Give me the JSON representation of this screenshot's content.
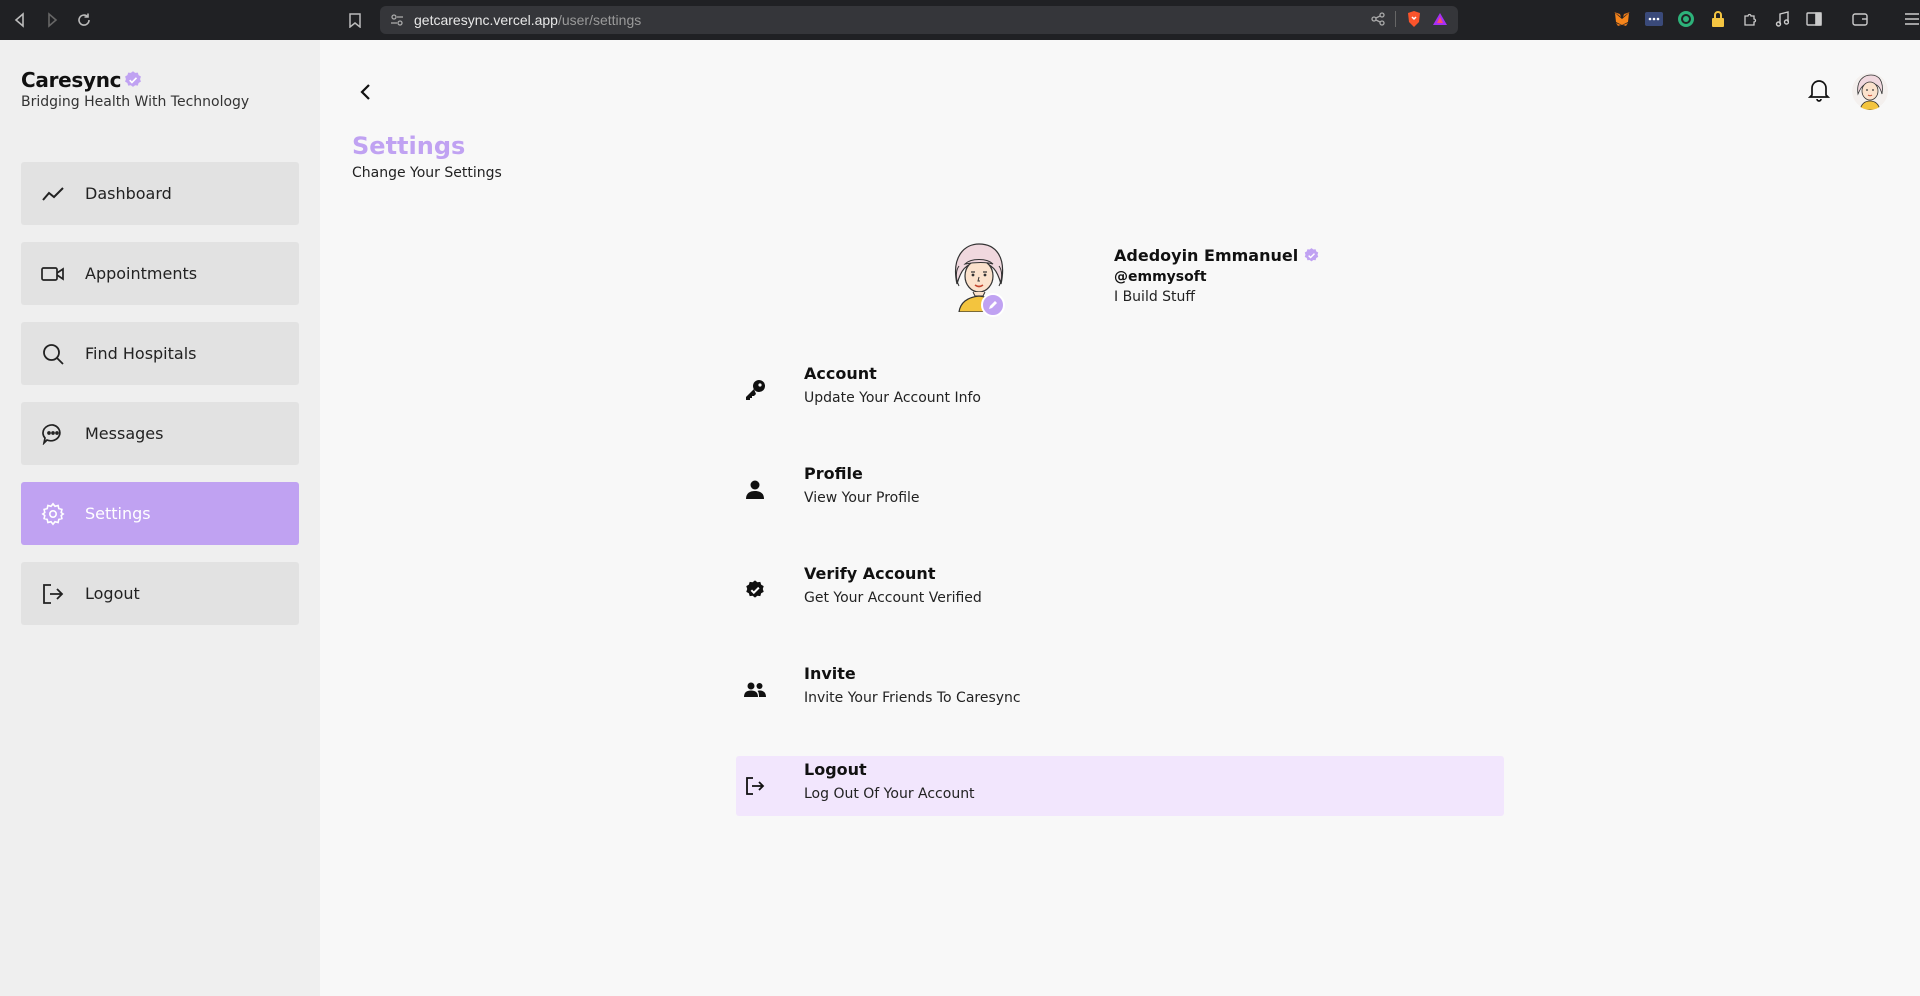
{
  "browser": {
    "url_host": "getcaresync.vercel.app",
    "url_path": "/user/settings"
  },
  "sidebar": {
    "brand_name": "Caresync",
    "tagline": "Bridging Health With Technology",
    "items": [
      {
        "label": "Dashboard",
        "icon": "chart-line-icon",
        "active": false
      },
      {
        "label": "Appointments",
        "icon": "video-icon",
        "active": false
      },
      {
        "label": "Find Hospitals",
        "icon": "search-icon",
        "active": false
      },
      {
        "label": "Messages",
        "icon": "chat-icon",
        "active": false
      },
      {
        "label": "Settings",
        "icon": "gear-icon",
        "active": true
      },
      {
        "label": "Logout",
        "icon": "logout-icon",
        "active": false
      }
    ]
  },
  "header": {
    "title": "Settings",
    "subtitle": "Change Your Settings"
  },
  "profile": {
    "name": "Adedoyin Emmanuel",
    "handle": "@emmysoft",
    "bio": "I Build Stuff"
  },
  "settings": [
    {
      "title": "Account",
      "description": "Update Your Account Info",
      "icon": "key-icon"
    },
    {
      "title": "Profile",
      "description": "View Your Profile",
      "icon": "person-icon"
    },
    {
      "title": "Verify Account",
      "description": "Get Your Account Verified",
      "icon": "verified-check-icon"
    },
    {
      "title": "Invite",
      "description": "Invite Your Friends To Caresync",
      "icon": "people-icon"
    },
    {
      "title": "Logout",
      "description": "Log Out Of Your Account",
      "icon": "logout-icon"
    }
  ],
  "colors": {
    "accent": "#c0a2f2",
    "logout_highlight": "#f2e6fd",
    "sidebar_bg": "#efefef",
    "sidebar_item_bg": "#e2e2e2"
  }
}
